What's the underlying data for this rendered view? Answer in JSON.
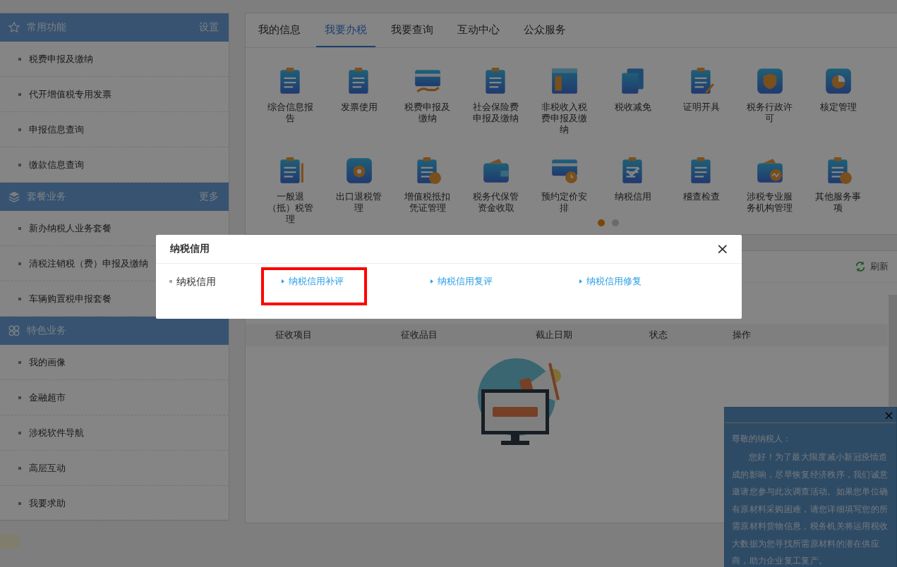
{
  "sidebar": {
    "sections": [
      {
        "title": "常用功能",
        "action": "设置",
        "items": [
          "税费申报及缴纳",
          "代开增值税专用发票",
          "申报信息查询",
          "缴款信息查询"
        ]
      },
      {
        "title": "套餐业务",
        "action": "更多",
        "items": [
          "新办纳税人业务套餐",
          "清税注销税（费）申报及缴纳",
          "车辆购置税申报套餐"
        ]
      },
      {
        "title": "特色业务",
        "items": [
          "我的画像",
          "金融超市",
          "涉税软件导航",
          "高层互动",
          "我要求助"
        ]
      }
    ]
  },
  "tabs": [
    {
      "label": "我的信息",
      "selected": false
    },
    {
      "label": "我要办税",
      "selected": true
    },
    {
      "label": "我要查询",
      "selected": false
    },
    {
      "label": "互动中心",
      "selected": false
    },
    {
      "label": "公众服务",
      "selected": false
    }
  ],
  "services": [
    {
      "label": "综合信息报告"
    },
    {
      "label": "发票使用"
    },
    {
      "label": "税费申报及缴纳"
    },
    {
      "label": "社会保险费申报及缴纳"
    },
    {
      "label": "非税收入税费申报及缴纳"
    },
    {
      "label": "税收减免"
    },
    {
      "label": "证明开具"
    },
    {
      "label": "税务行政许可"
    },
    {
      "label": "核定管理"
    },
    {
      "label": "一般退（抵）税管理"
    },
    {
      "label": "出口退税管理"
    },
    {
      "label": "增值税抵扣凭证管理"
    },
    {
      "label": "税务代保管资金收取"
    },
    {
      "label": "预约定价安排"
    },
    {
      "label": "纳税信用"
    },
    {
      "label": "稽查检查"
    },
    {
      "label": "涉税专业服务机构管理"
    },
    {
      "label": "其他服务事项"
    }
  ],
  "carousel_dots": [
    {
      "selected": true
    },
    {
      "selected": false
    }
  ],
  "list_panel": {
    "refresh": "刷新",
    "columns": [
      "征收项目",
      "征收品目",
      "截止日期",
      "状态",
      "操作"
    ]
  },
  "modal": {
    "title": "纳税信用",
    "category": "纳税信用",
    "close": "×",
    "links": [
      {
        "label": "纳税信用补评",
        "highlighted": true
      },
      {
        "label": "纳税信用复评",
        "highlighted": false
      },
      {
        "label": "纳税信用修复",
        "highlighted": false
      }
    ]
  },
  "notice": {
    "close": "×",
    "greeting": "尊敬的纳税人：",
    "body": "您好！为了最大限度减小新冠疫情造成的影响，尽早恢复经济秩序，我们诚意邀请您参与此次调查活动。如果您单位确有原材料采购困难，请您详细填写您的所需原材料货物信息，税务机关将运用税收大数据为您寻找所需原材料的潜在供应商，助力企业复工复产。"
  }
}
